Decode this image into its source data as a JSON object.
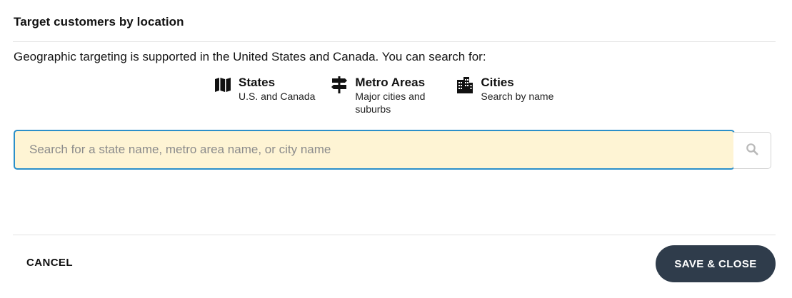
{
  "dialog": {
    "title": "Target customers by location",
    "intro": "Geographic targeting is supported in the United States and Canada. You can search for:"
  },
  "options": [
    {
      "icon": "map-icon",
      "label": "States",
      "description": "U.S. and Canada"
    },
    {
      "icon": "signpost-icon",
      "label": "Metro Areas",
      "description": "Major cities and suburbs"
    },
    {
      "icon": "city-icon",
      "label": "Cities",
      "description": "Search by name"
    }
  ],
  "search": {
    "placeholder": "Search for a state name, metro area name, or city name",
    "value": "",
    "icon": "search-icon"
  },
  "footer": {
    "cancel_label": "CANCEL",
    "save_label": "SAVE & CLOSE"
  },
  "colors": {
    "input_border": "#2b8fc9",
    "input_background": "#fef4d4",
    "save_button_background": "#2f3c4b"
  }
}
